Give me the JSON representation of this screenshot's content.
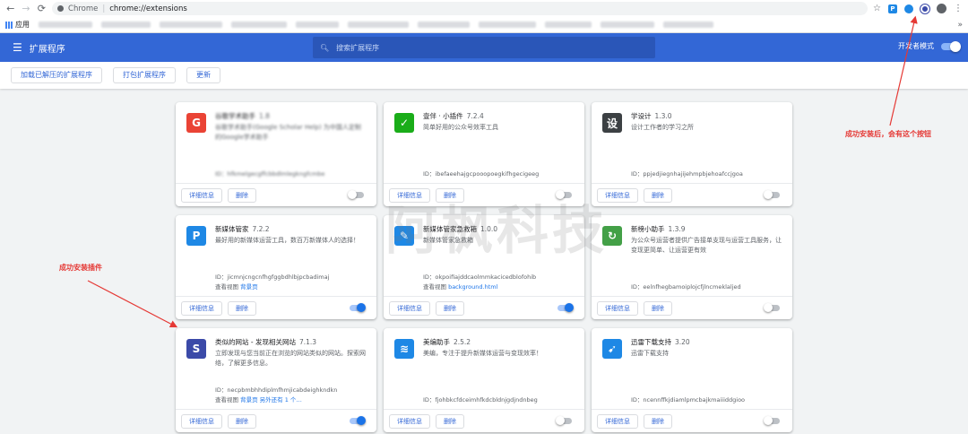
{
  "browser": {
    "url_scheme": "Chrome",
    "url": "chrome://extensions",
    "apps_label": "应用"
  },
  "header": {
    "title": "扩展程序",
    "search_placeholder": "搜索扩展程序",
    "dev_mode_label": "开发者模式",
    "dev_mode_on": true
  },
  "toolbar": {
    "load_unpacked": "加载已解压的扩展程序",
    "pack": "打包扩展程序",
    "update": "更新"
  },
  "buttons": {
    "details": "详细信息",
    "remove": "删除"
  },
  "extensions": [
    {
      "name": "谷歌学术助手",
      "version": "1.8",
      "desc": "谷歌学术助手(Google Scholar Help) 为中国人定制的Google学术助手",
      "id": "ID：hfkmelgecgffcbbdlmlegkngfcmbe",
      "view": "",
      "link": "",
      "enabled": false,
      "blurred": true,
      "icon": "google-scholar-icon",
      "icon_color": "#ea4335"
    },
    {
      "name": "壹伴 · 小插件",
      "version": "7.2.4",
      "desc": "简单好用的公众号效率工具",
      "id": "ID：ibefaeehajgcpooopoegkifhgecigeeg",
      "view": "",
      "link": "",
      "enabled": false,
      "blurred": false,
      "icon": "yiban-icon",
      "icon_color": "#1aad19"
    },
    {
      "name": "学设计",
      "version": "1.3.0",
      "desc": "设计工作者的学习之所",
      "id": "ID：ppjedjiegnhajijehmpbjehoafccjgoa",
      "view": "",
      "link": "",
      "enabled": false,
      "blurred": false,
      "icon": "xuesheji-icon",
      "icon_color": "#3c4043"
    },
    {
      "name": "新媒体管家",
      "version": "7.2.2",
      "desc": "最好用的新媒体运营工具，数百万新媒体人的选择！",
      "id": "ID：jicmnjcngcnfhgfggbdhlbjpcbadimaj",
      "view": "查看视图",
      "link": "背景页",
      "enabled": true,
      "blurred": false,
      "icon": "p-icon",
      "icon_color": "#1e88e5"
    },
    {
      "name": "新媒体管家急救箱",
      "version": "1.0.0",
      "desc": "新媒体管家急救箱",
      "id": "ID：okpoifiajddcaolmmkacicedblofohib",
      "view": "查看视图",
      "link": "background.html",
      "enabled": true,
      "blurred": false,
      "icon": "wrench-icon",
      "icon_color": "#1e88e5"
    },
    {
      "name": "新榜小助手",
      "version": "1.3.9",
      "desc": "为公众号运营者提供广告接单支现与运营工具服务，让变现更简单、让运营更有效",
      "id": "ID：eelnfhegbamoiplojcfjlncmeklaljed",
      "view": "",
      "link": "",
      "enabled": false,
      "blurred": false,
      "icon": "xinbang-icon",
      "icon_color": "#43a047"
    },
    {
      "name": "类似的网站 - 发现相关网站",
      "version": "7.1.3",
      "desc": "立即发现与您当前正在浏览的网站类似的网站。探索网络，了解更多信息。",
      "id": "ID：necpbmbhhdiplmfhmjicabdeighkndkn",
      "view": "查看视图",
      "link": "背景页 另外还有 1 个…",
      "enabled": true,
      "blurred": false,
      "icon": "similar-sites-icon",
      "icon_color": "#3b4aa8"
    },
    {
      "name": "美编助手",
      "version": "2.5.2",
      "desc": "美编，专注于提升新媒体运营与变现效率！",
      "id": "ID：fjohbkcfdceimhfkdcbldnjgdjndnbeg",
      "view": "",
      "link": "",
      "enabled": false,
      "blurred": false,
      "icon": "meibian-icon",
      "icon_color": "#1e88e5"
    },
    {
      "name": "迅雷下载支持",
      "version": "3.20",
      "desc": "迅雷下载支持",
      "id": "ID：ncennffkjdiamlpmcbajkmaiiiddgioo",
      "view": "",
      "link": "",
      "enabled": false,
      "blurred": false,
      "icon": "thunder-icon",
      "icon_color": "#1e88e5"
    }
  ],
  "annotations": {
    "install_success_button": "成功安装后，会有这个按钮",
    "install_success_plugin": "成功安装插件",
    "watermark": "阿枫科技",
    "color": "#e53935"
  }
}
